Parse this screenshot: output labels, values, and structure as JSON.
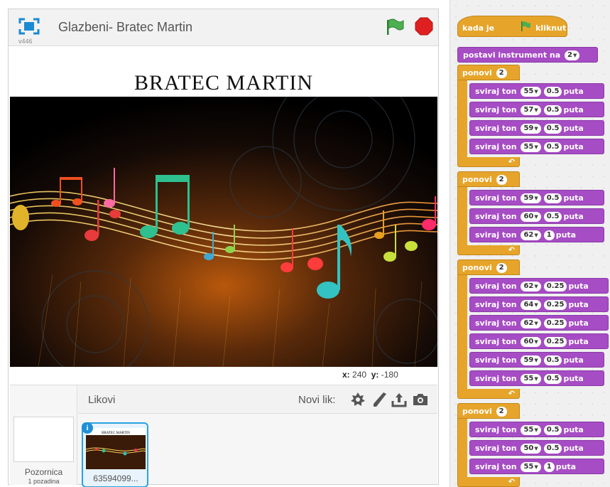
{
  "stage": {
    "version": "v446",
    "project_title": "Glazbeni- Bratec Martin",
    "stage_text": "BRATEC MARTIN",
    "coords": {
      "x_label": "x:",
      "x_value": "240",
      "y_label": "y:",
      "y_value": "-180"
    }
  },
  "sprites": {
    "header_label": "Likovi",
    "new_sprite_label": "Novi lik:",
    "stage_label": "Pozornica",
    "backdrop_count": "1 pozadina",
    "sprite_name": "63594099...",
    "info_badge": "i",
    "thumb_caption": "BRATEC MARTIN"
  },
  "script": {
    "hat": {
      "pre": "kada je",
      "post": "kliknut"
    },
    "set_instrument": {
      "label": "postavi instrument na",
      "value": "2"
    },
    "loop_label": "ponovi",
    "note_label": "sviraj ton",
    "times_label": "puta",
    "loops": [
      {
        "repeat": "2",
        "notes": [
          {
            "note": "55",
            "beats": "0.5"
          },
          {
            "note": "57",
            "beats": "0.5"
          },
          {
            "note": "59",
            "beats": "0.5"
          },
          {
            "note": "55",
            "beats": "0.5"
          }
        ]
      },
      {
        "repeat": "2",
        "notes": [
          {
            "note": "59",
            "beats": "0.5"
          },
          {
            "note": "60",
            "beats": "0.5"
          },
          {
            "note": "62",
            "beats": "1"
          }
        ]
      },
      {
        "repeat": "2",
        "notes": [
          {
            "note": "62",
            "beats": "0.25"
          },
          {
            "note": "64",
            "beats": "0.25"
          },
          {
            "note": "62",
            "beats": "0.25"
          },
          {
            "note": "60",
            "beats": "0.25"
          },
          {
            "note": "59",
            "beats": "0.5"
          },
          {
            "note": "55",
            "beats": "0.5"
          }
        ]
      },
      {
        "repeat": "2",
        "notes": [
          {
            "note": "55",
            "beats": "0.5"
          },
          {
            "note": "50",
            "beats": "0.5"
          },
          {
            "note": "55",
            "beats": "1"
          }
        ]
      }
    ]
  },
  "colors": {
    "control": "#e6a52a",
    "sound": "#a64cc4",
    "flag": "#4caf50",
    "stop": "#e02020",
    "selection": "#29a3e0"
  },
  "icons": [
    "fullscreen-icon",
    "green-flag-icon",
    "stop-icon",
    "choose-sprite-icon",
    "paint-icon",
    "upload-icon",
    "camera-icon",
    "repeat-arrow-icon"
  ]
}
